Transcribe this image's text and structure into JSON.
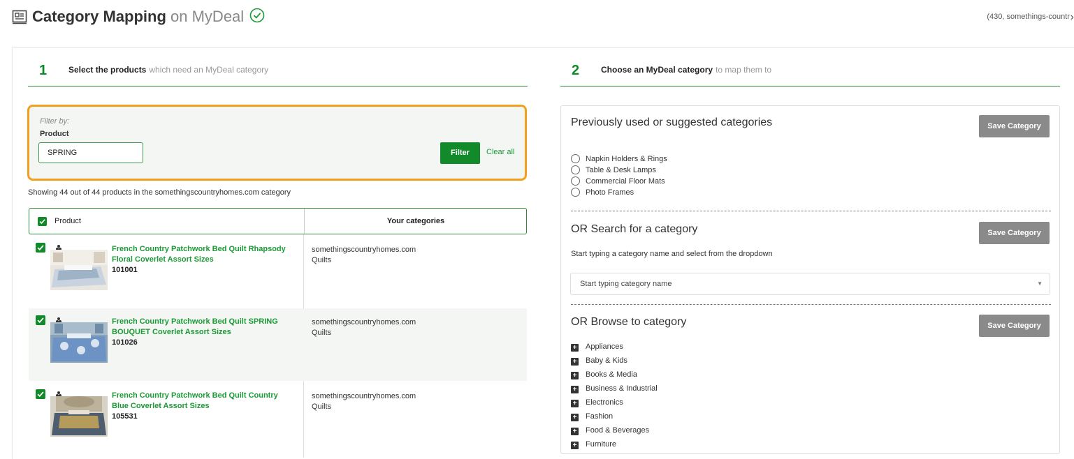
{
  "header": {
    "title_bold": "Category Mapping",
    "title_rest": " on MyDeal",
    "account_info": "(430, somethings-countr",
    "chevron": "›"
  },
  "steps": [
    {
      "number": "1",
      "label": "Select the products",
      "sub": "which need an MyDeal category"
    },
    {
      "number": "2",
      "label": "Choose an MyDeal category",
      "sub": "to map them to"
    }
  ],
  "filter": {
    "filter_by": "Filter by:",
    "product_label": "Product",
    "product_value": "SPRING",
    "filter_button": "Filter",
    "clear_all": "Clear all"
  },
  "showing_text": "Showing 44 out of 44 products in the somethingscountryhomes.com category",
  "table": {
    "col_product": "Product",
    "col_categories": "Your categories",
    "rows": [
      {
        "name": "French Country Patchwork Bed Quilt Rhapsody Floral Coverlet Assort Sizes",
        "sku": "101001",
        "shop": "somethingscountryhomes.com",
        "category": "Quilts"
      },
      {
        "name": "French Country Patchwork Bed Quilt SPRING BOUQUET Coverlet Assort Sizes",
        "sku": "101026",
        "shop": "somethingscountryhomes.com",
        "category": "Quilts"
      },
      {
        "name": "French Country Patchwork Bed Quilt Country Blue Coverlet Assort Sizes",
        "sku": "105531",
        "shop": "somethingscountryhomes.com",
        "category": "Quilts"
      }
    ]
  },
  "right": {
    "suggested_title": "Previously used or suggested categories",
    "save_label": "Save Category",
    "suggested": [
      "Napkin Holders & Rings",
      "Table & Desk Lamps",
      "Commercial Floor Mats",
      "Photo Frames"
    ],
    "search_title": "OR Search for a category",
    "search_hint": "Start typing a category name and select from the dropdown",
    "search_placeholder": "Start typing category name",
    "browse_title": "OR Browse to category",
    "browse": [
      "Appliances",
      "Baby & Kids",
      "Books & Media",
      "Business & Industrial",
      "Electronics",
      "Fashion",
      "Food & Beverages",
      "Furniture"
    ]
  },
  "colors": {
    "brand_green": "#128a2a",
    "highlight_orange": "#f0a01c",
    "save_gray": "#8a8a8a"
  }
}
